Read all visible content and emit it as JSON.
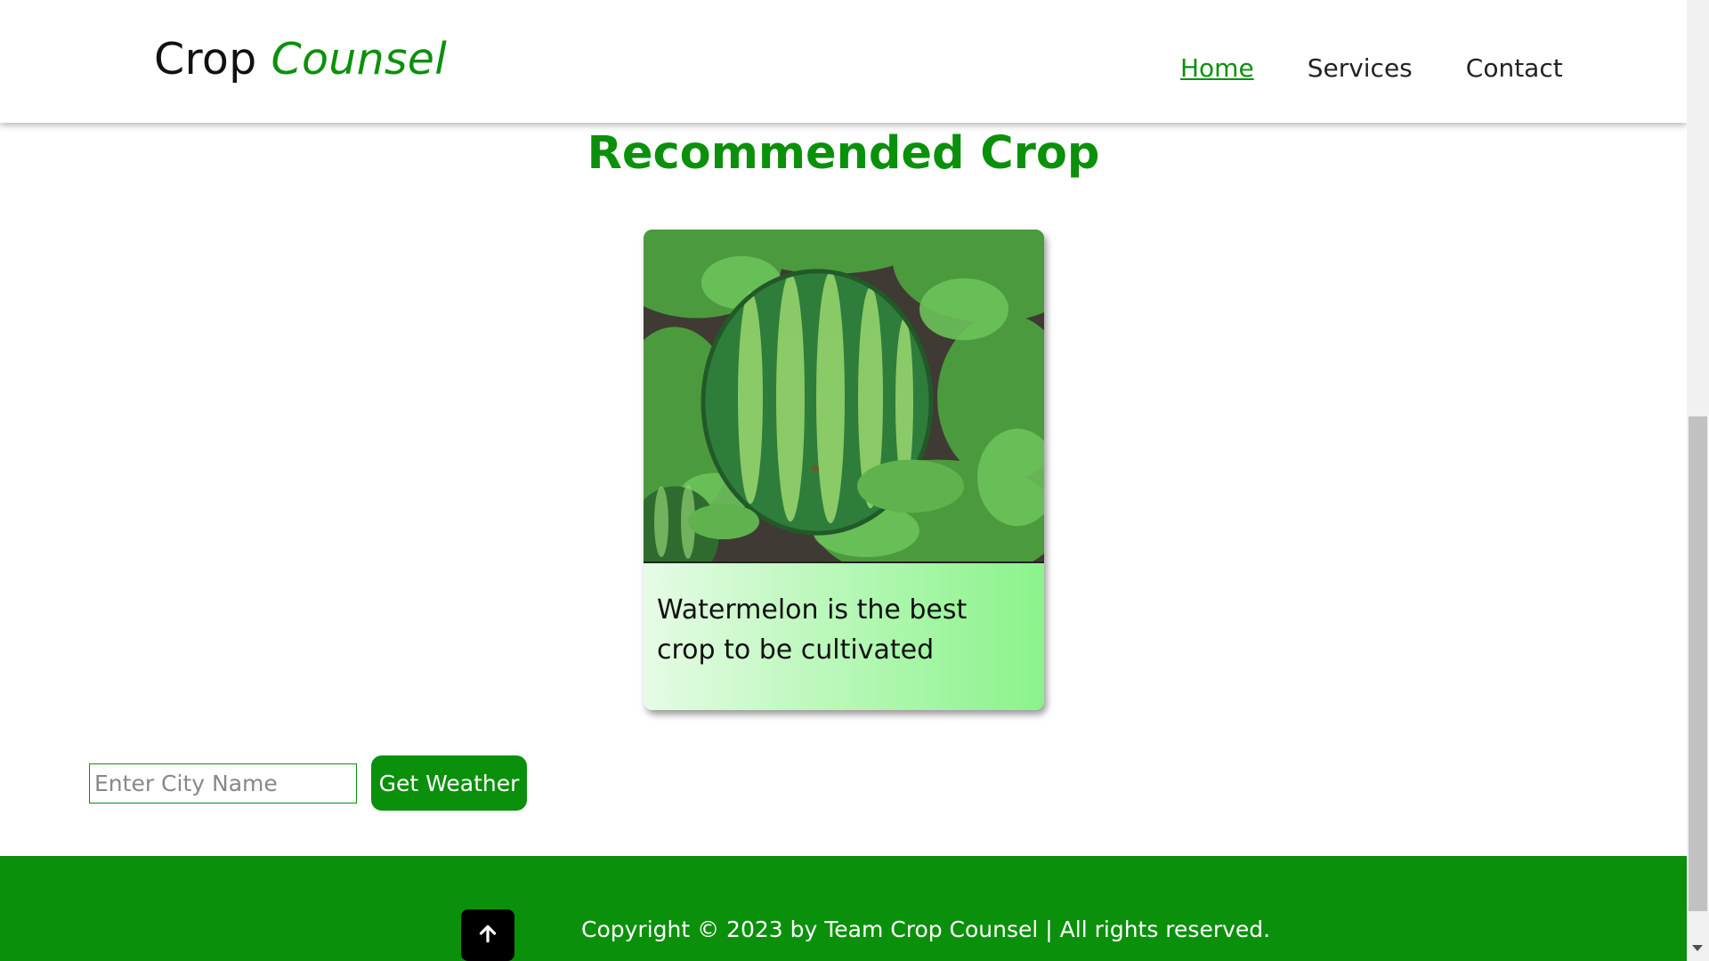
{
  "header": {
    "brand_part1": "Crop",
    "brand_part2": "Counsel",
    "nav": [
      {
        "label": "Home",
        "active": true
      },
      {
        "label": "Services",
        "active": false
      },
      {
        "label": "Contact",
        "active": false
      }
    ]
  },
  "main": {
    "title": "Recommended Crop",
    "card": {
      "image_subject": "watermelon-photo",
      "text": "Watermelon is the best crop to be cultivated"
    },
    "weather": {
      "city_placeholder": "Enter City Name",
      "city_value": "",
      "button_label": "Get Weather"
    }
  },
  "footer": {
    "copyright": "Copyright © 2023 by Team Crop Counsel | All rights reserved.",
    "top_icon": "arrow-up-icon"
  },
  "colors": {
    "accent": "#0b900b",
    "card_gradient_start": "#e6fbe6",
    "card_gradient_end": "#8af38a"
  }
}
